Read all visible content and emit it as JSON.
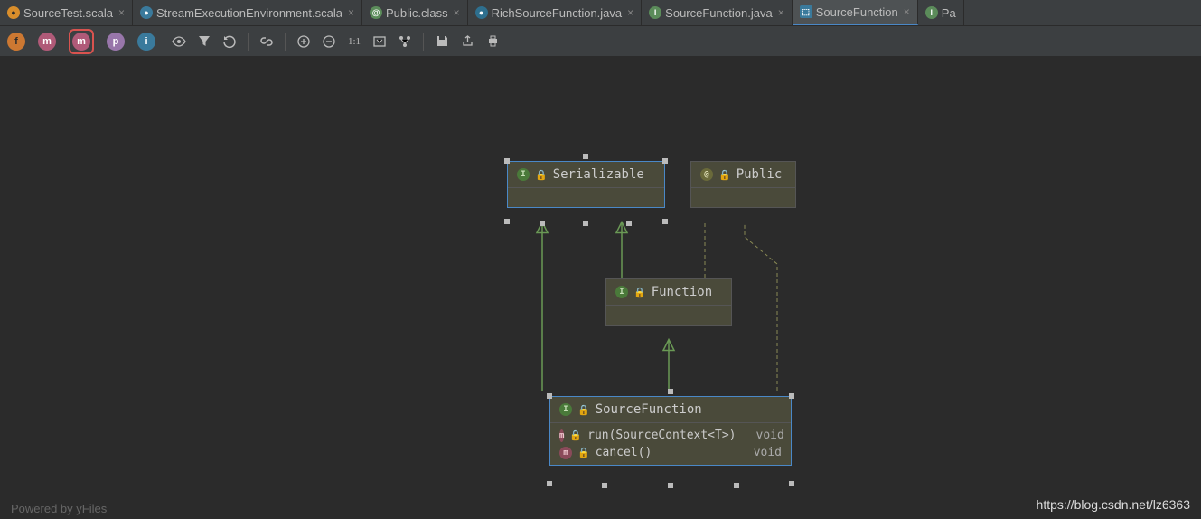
{
  "tabs": [
    {
      "icon": "scala-o",
      "label": "SourceTest.scala"
    },
    {
      "icon": "scala-c",
      "label": "StreamExecutionEnvironment.scala"
    },
    {
      "icon": "class-at",
      "label": "Public.class"
    },
    {
      "icon": "java-c",
      "label": "RichSourceFunction.java"
    },
    {
      "icon": "java-i",
      "label": "SourceFunction.java"
    },
    {
      "icon": "diagram",
      "label": "SourceFunction",
      "active": true
    },
    {
      "icon": "java-i",
      "label": "Pa"
    }
  ],
  "toolbar": {
    "round": [
      {
        "name": "fields-button",
        "cls": "tbtn-f",
        "label": "f"
      },
      {
        "name": "constructors-button",
        "cls": "tbtn-m",
        "label": "m"
      },
      {
        "name": "methods-button",
        "cls": "tbtn-m2",
        "label": "m",
        "highlight": true
      },
      {
        "name": "properties-button",
        "cls": "tbtn-p",
        "label": "p"
      },
      {
        "name": "inner-classes-button",
        "cls": "tbtn-i",
        "label": "i"
      }
    ]
  },
  "nodes": {
    "serializable": {
      "title": "Serializable"
    },
    "public": {
      "title": "Public"
    },
    "function": {
      "title": "Function"
    },
    "sourceFunction": {
      "title": "SourceFunction",
      "methods": [
        {
          "sig": "run(SourceContext<T>)",
          "ret": "void"
        },
        {
          "sig": "cancel()",
          "ret": "void"
        }
      ]
    }
  },
  "footer": {
    "left": "Powered by yFiles",
    "right": "https://blog.csdn.net/lz6363"
  }
}
